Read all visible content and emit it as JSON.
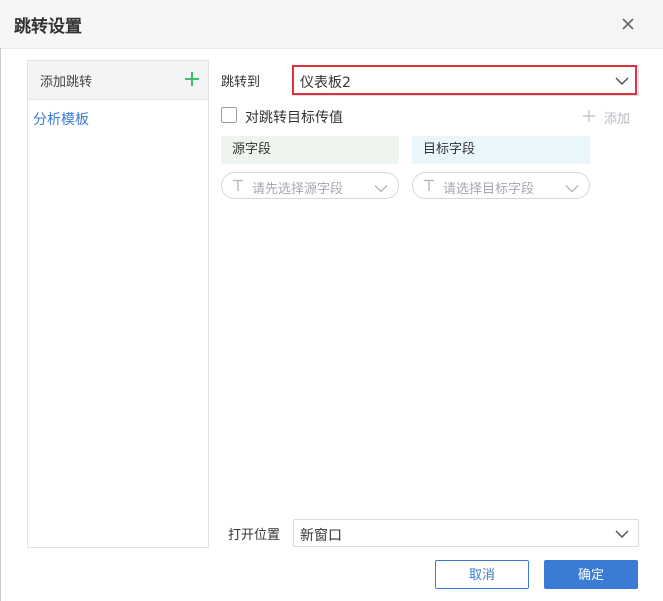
{
  "dialog": {
    "title": "跳转设置",
    "close_icon": "close-icon"
  },
  "left_panel": {
    "header_label": "添加跳转",
    "add_icon": "plus-icon",
    "items": [
      {
        "label": "分析模板"
      }
    ]
  },
  "jump": {
    "label": "跳转到",
    "selected": "仪表板2"
  },
  "pass_value": {
    "label": "对跳转目标传值",
    "checked": false,
    "add_label": "添加"
  },
  "mapping": {
    "source_header": "源字段",
    "target_header": "目标字段",
    "source_placeholder": "请先选择源字段",
    "target_placeholder": "请选择目标字段"
  },
  "open_position": {
    "label": "打开位置",
    "selected": "新窗口"
  },
  "buttons": {
    "cancel": "取消",
    "ok": "确定"
  },
  "colors": {
    "accent": "#3a7bd5",
    "highlight": "#e0313a",
    "add_green": "#2fb55d"
  }
}
